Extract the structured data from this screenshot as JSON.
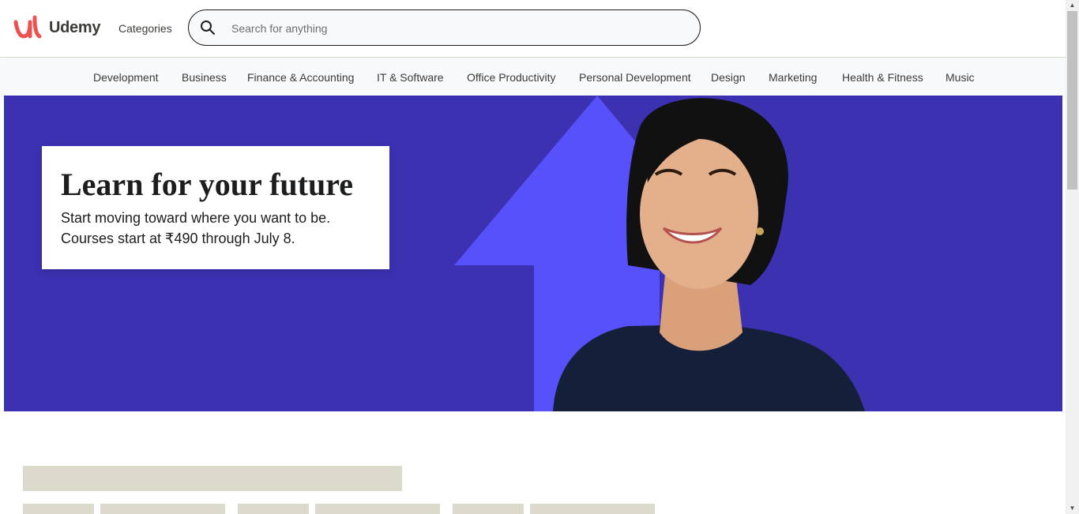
{
  "header": {
    "logo_text": "Udemy",
    "categories_label": "Categories",
    "search_placeholder": "Search for anything"
  },
  "nav": {
    "items": [
      "Development",
      "Business",
      "Finance & Accounting",
      "IT & Software",
      "Office Productivity",
      "Personal Development",
      "Design",
      "Marketing",
      "Health & Fitness",
      "Music"
    ]
  },
  "hero": {
    "title": "Learn for your future",
    "subtitle_line1": "Start moving toward where you want to be.",
    "subtitle_line2": "Courses start at ₹490 through July 8."
  },
  "colors": {
    "brand_red": "#ec5252",
    "hero_bg": "#3b31b1",
    "arrow": "#5651fb",
    "skeleton": "#dcdacb"
  },
  "icons": [
    "udemy-logo-icon",
    "search-icon",
    "scroll-up-icon",
    "scroll-down-icon"
  ]
}
